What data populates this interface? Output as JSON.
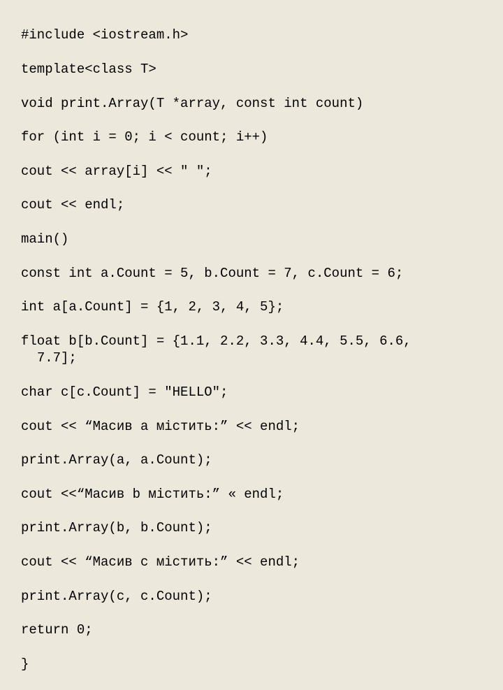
{
  "code": {
    "l01": "#include <iostream.h>",
    "l02": "template<class T>",
    "l03": "void print.Array(T *array, const int count)",
    "l04": "for (int i = 0; i < count; i++)",
    "l05": "cout << array[i] << \" \";",
    "l06": "cout << endl;",
    "l07": "main()",
    "l08": "const int a.Count = 5, b.Count = 7, c.Count = 6;",
    "l09": "int a[a.Count] = {1, 2, 3, 4, 5};",
    "l10": "float b[b.Count] = {1.1, 2.2, 3.3, 4.4, 5.5, 6.6,\n  7.7];",
    "l11": "char c[c.Count] = \"HELLO\";",
    "l12": "cout << “Масив a містить:” << endl;",
    "l13": "print.Array(a, a.Count);",
    "l14": "cout <<“Масив b містить:” « endl;",
    "l15": "print.Array(b, b.Count);",
    "l16": "cout << “Масив c містить:” << endl;",
    "l17": "print.Array(c, c.Count);",
    "l18": "return 0;",
    "l19": "}"
  }
}
